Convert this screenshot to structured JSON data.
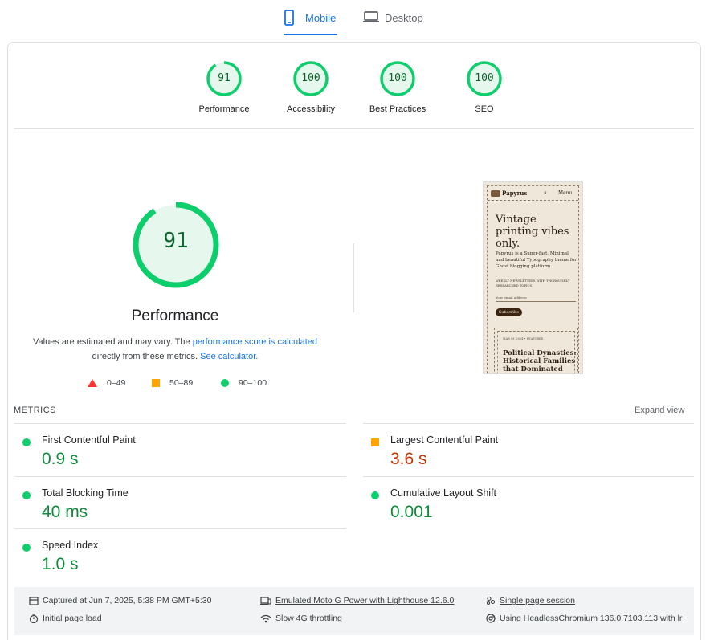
{
  "tabs": {
    "mobile": "Mobile",
    "desktop": "Desktop"
  },
  "categories": [
    {
      "score": "91",
      "label": "Performance",
      "fraction": 0.91
    },
    {
      "score": "100",
      "label": "Accessibility",
      "fraction": 1.0
    },
    {
      "score": "100",
      "label": "Best Practices",
      "fraction": 1.0
    },
    {
      "score": "100",
      "label": "SEO",
      "fraction": 1.0
    }
  ],
  "performance": {
    "score": "91",
    "fraction": 0.91,
    "title": "Performance",
    "desc_1": "Values are estimated and may vary. The ",
    "desc_link_1": "performance score is calculated",
    "desc_2": " directly from these metrics. ",
    "desc_link_2": "See calculator."
  },
  "legend": {
    "fail": "0–49",
    "average": "50–89",
    "pass": "90–100"
  },
  "screenshot": {
    "logo": "Papyrus",
    "menu": "Menu",
    "headline": "Vintage printing vibes only.",
    "text": "Papyrus is a Super-fast, Minimal and beautiful Typography theme for Ghost blogging platform.",
    "small": "WEEKLY NEWSLETTERS WITH THOROUGHLY RESEARCHED TOPICS",
    "email": "Your email address",
    "button": "Subscribe",
    "meta": "MAR 09, 2024 • FEATURED",
    "card_title": "Political Dynasties: Historical Families that Dominated"
  },
  "metrics": {
    "title": "METRICS",
    "expand": "Expand view",
    "items": [
      {
        "label": "First Contentful Paint",
        "value": "0.9 s",
        "rating": "pass"
      },
      {
        "label": "Largest Contentful Paint",
        "value": "3.6 s",
        "rating": "average"
      },
      {
        "label": "Total Blocking Time",
        "value": "40 ms",
        "rating": "pass"
      },
      {
        "label": "Cumulative Layout Shift",
        "value": "0.001",
        "rating": "pass"
      },
      {
        "label": "Speed Index",
        "value": "1.0 s",
        "rating": "pass"
      }
    ]
  },
  "footer": {
    "captured": "Captured at Jun 7, 2025, 5:38 PM GMT+5:30",
    "initial_load": "Initial page load",
    "device": "Emulated Moto G Power with Lighthouse 12.6.0",
    "throttling": "Slow 4G throttling",
    "session": "Single page session",
    "browser": "Using HeadlessChromium 136.0.7103.113 with lr"
  },
  "colors": {
    "pass": "#0cce6b",
    "average": "#ffa400",
    "fail": "#ff3333",
    "accent": "#1a73e8"
  }
}
